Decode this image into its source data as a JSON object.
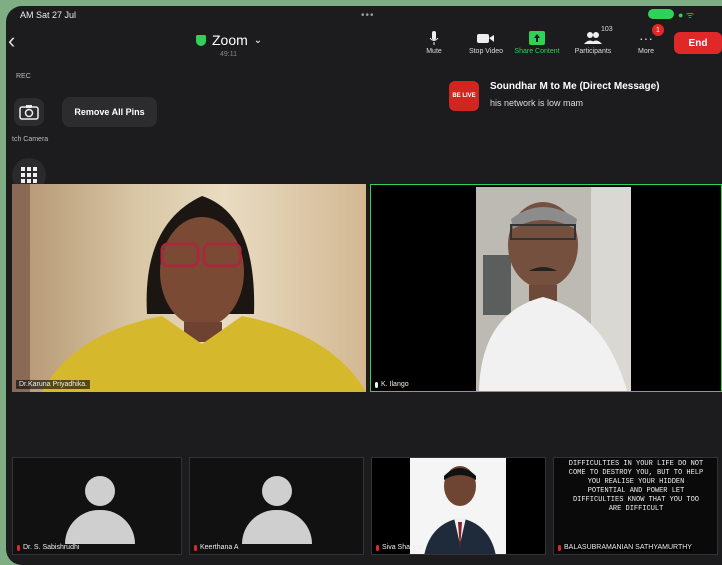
{
  "status_bar": {
    "time": "AM",
    "date": "Sat 27 Jul",
    "dots": "•••"
  },
  "header": {
    "title": "Zoom",
    "timer": "49:11"
  },
  "toolbar": {
    "mute": "Mute",
    "stop_video": "Stop Video",
    "share_content": "Share Content",
    "participants": "Participants",
    "participant_count": "103",
    "more": "More",
    "more_badge": "1",
    "end": "End"
  },
  "left_panel": {
    "rec": "REC",
    "camera_label": "tch Camera",
    "remove_pins": "Remove All Pins"
  },
  "chat": {
    "avatar_text": "BE LIVE",
    "from": "Soundhar M to Me (Direct Message)",
    "message": "his network is low mam"
  },
  "tiles": {
    "main1_name": "Dr.Karuna Priyadhika.",
    "main2_name": "K. Ilango",
    "t1_name": "Dr. S. Sabishrudhi",
    "t2_name": "Keerthana A",
    "t3_name": "Siva Shankar",
    "t4_name": "BALASUBRAMANIAN SATHYAMURTHY",
    "t4_quote": "DIFFICULTIES IN YOUR LIFE DO NOT COME TO DESTROY YOU, BUT TO HELP YOU REALISE YOUR HIDDEN POTENTIAL AND POWER LET DIFFICULTIES KNOW THAT YOU TOO ARE DIFFICULT"
  },
  "colors": {
    "accent_green": "#30d158",
    "end_red": "#e02828",
    "active_border": "#30d158"
  }
}
